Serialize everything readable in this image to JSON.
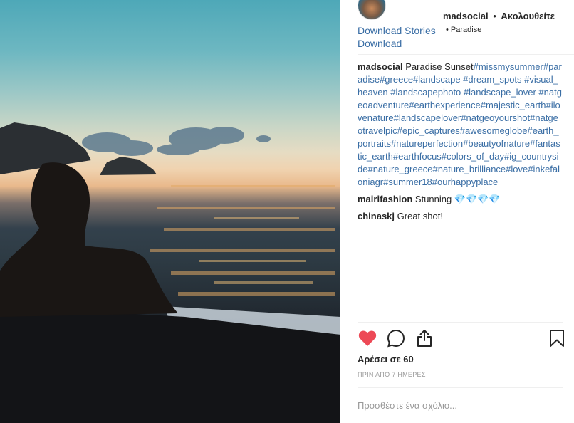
{
  "post": {
    "photo_alt": "Sunset over the sea seen from a boat",
    "header": {
      "username": "madsocial",
      "separator": "•",
      "follow_label": "Ακολουθείτε",
      "location": "• Paradise",
      "download_stories": "Download Stories",
      "download": "Download"
    },
    "caption": {
      "user": "madsocial",
      "text": "Paradise Sunset",
      "hashtags": "#missmysummer#paradise#greece#landscape #dream_spots #visual_heaven #landscapephoto #landscape_lover #natgeoadventure#earthexperience#majestic_earth#ilovenature#landscapelover#natgeoyourshot#natgeotravelpic#epic_captures#awesomeglobe#earth_portraits#natureperfection#beautyofnature#fantastic_earth#earthfocus#colors_of_day#ig_countryside#nature_greece#nature_brilliance#love#inkefaloniagr#summer18#ourhappyplace"
    },
    "comments": [
      {
        "user": "mairifashion",
        "text": "Stunning",
        "gems": "💎💎💎💎"
      },
      {
        "user": "chinaskj",
        "text": "Great shot!"
      }
    ],
    "likes": "Αρέσει σε 60",
    "time": "ΠΡΙΝ ΑΠΟ 7 ΗΜΕΡΕΣ",
    "add_comment_placeholder": "Προσθέστε ένα σχόλιο...",
    "icons": {
      "like": "heart-filled-icon",
      "comment": "speech-bubble-icon",
      "share": "share-upload-icon",
      "save": "bookmark-icon"
    },
    "colors": {
      "heart": "#ed4956",
      "link": "#3a6ea5",
      "text": "#262626",
      "muted": "#999999"
    }
  }
}
